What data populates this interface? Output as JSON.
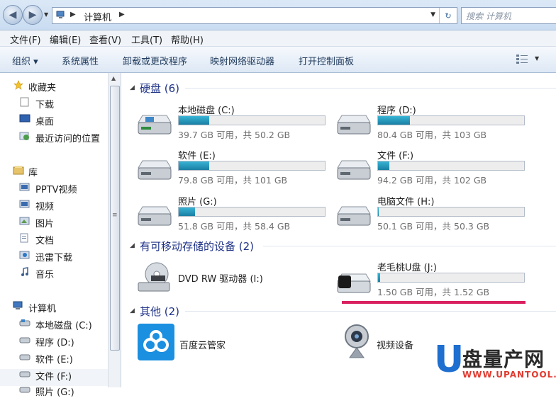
{
  "address": {
    "crumb": "计算机",
    "search_placeholder": "搜索 计算机"
  },
  "menu": [
    "文件(F)",
    "编辑(E)",
    "查看(V)",
    "工具(T)",
    "帮助(H)"
  ],
  "toolbar": [
    "组织 ▾",
    "系统属性",
    "卸载或更改程序",
    "映射网络驱动器",
    "打开控制面板"
  ],
  "sidebar": {
    "favorites": {
      "title": "收藏夹",
      "items": [
        "下载",
        "桌面",
        "最近访问的位置"
      ]
    },
    "library": {
      "title": "库",
      "items": [
        "PPTV视频",
        "视频",
        "图片",
        "文档",
        "迅雷下载",
        "音乐"
      ]
    },
    "computer": {
      "title": "计算机",
      "items": [
        "本地磁盘 (C:)",
        "程序 (D:)",
        "软件 (E:)",
        "文件 (F:)",
        "照片 (G:)"
      ]
    }
  },
  "groups": {
    "hdd": "硬盘 (6)",
    "removable": "有可移动存储的设备 (2)",
    "other": "其他 (2)"
  },
  "drives": [
    {
      "name": "本地磁盘 (C:)",
      "info": "39.7 GB 可用，共 50.2 GB",
      "used_fraction": 0.21
    },
    {
      "name": "程序 (D:)",
      "info": "80.4 GB 可用，共 103 GB",
      "used_fraction": 0.22
    },
    {
      "name": "软件 (E:)",
      "info": "79.8 GB 可用，共 101 GB",
      "used_fraction": 0.21
    },
    {
      "name": "文件 (F:)",
      "info": "94.2 GB 可用，共 102 GB",
      "used_fraction": 0.08
    },
    {
      "name": "照片 (G:)",
      "info": "51.8 GB 可用，共 58.4 GB",
      "used_fraction": 0.11
    },
    {
      "name": "电脑文件 (H:)",
      "info": "50.1 GB 可用，共 50.3 GB",
      "used_fraction": 0.004
    }
  ],
  "removable": [
    {
      "name": "DVD RW 驱动器 (I:)"
    },
    {
      "name": "老毛桃U盘 (J:)",
      "info": "1.50 GB 可用，共 1.52 GB",
      "used_fraction": 0.013
    }
  ],
  "other": [
    "百度云管家",
    "视频设备"
  ],
  "watermark": {
    "u": "U",
    "cn": "盘量产网",
    "url": "WWW.UPANTOOL.COM"
  }
}
